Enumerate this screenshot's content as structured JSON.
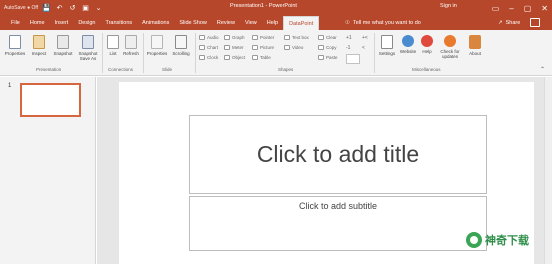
{
  "titlebar": {
    "autosave": "AutoSave ● Off",
    "title": "Presentation1 - PowerPoint",
    "signin": "Sign in",
    "qat": [
      "save-icon",
      "undo-icon",
      "redo-icon",
      "present-icon",
      "customize-icon"
    ],
    "window_buttons": [
      "▭",
      "–",
      "▢",
      "✕"
    ]
  },
  "tabs": [
    "File",
    "Home",
    "Insert",
    "Design",
    "Transitions",
    "Animations",
    "Slide Show",
    "Review",
    "View",
    "Help",
    "DataPoint"
  ],
  "active_tab": "DataPoint",
  "tellme": "Tell me what you want to do",
  "share": "Share",
  "ribbon": {
    "groups": {
      "presentation": "Presentation",
      "connections": "Connections",
      "slide": "Slide",
      "shapes": "Shapes",
      "miscellaneous": "Miscellaneous"
    },
    "buttons": {
      "properties": "Properties",
      "inspect": "Inspect",
      "snapshot": "Snapshot",
      "snapshot_save": "Snapshot Save As",
      "list": "List",
      "refresh": "Refresh",
      "slide_properties": "Properties",
      "scrolling": "Scrolling",
      "settings": "Settings",
      "website": "Website",
      "help": "Help",
      "check_updates": "Check for updates",
      "about": "About"
    },
    "shapes": {
      "audio": "Audio",
      "graph": "Graph",
      "pointer": "Pointer",
      "text_box": "Text box",
      "clear": "Clear",
      "chart": "Chart",
      "meter": "Meter",
      "picture": "Picture",
      "video": "Video",
      "copy": "Copy",
      "clock": "Clock",
      "object": "Object",
      "table": "Table",
      "paste": "Paste"
    }
  },
  "thumbnails": [
    {
      "number": "1"
    }
  ],
  "slide": {
    "title_placeholder": "Click to add title",
    "subtitle_placeholder": "Click to add subtitle"
  },
  "watermark": "神奇下载",
  "colors": {
    "accent": "#b7472a",
    "ribbon": "#f3f3f3",
    "thumb_border": "#d5663f"
  }
}
